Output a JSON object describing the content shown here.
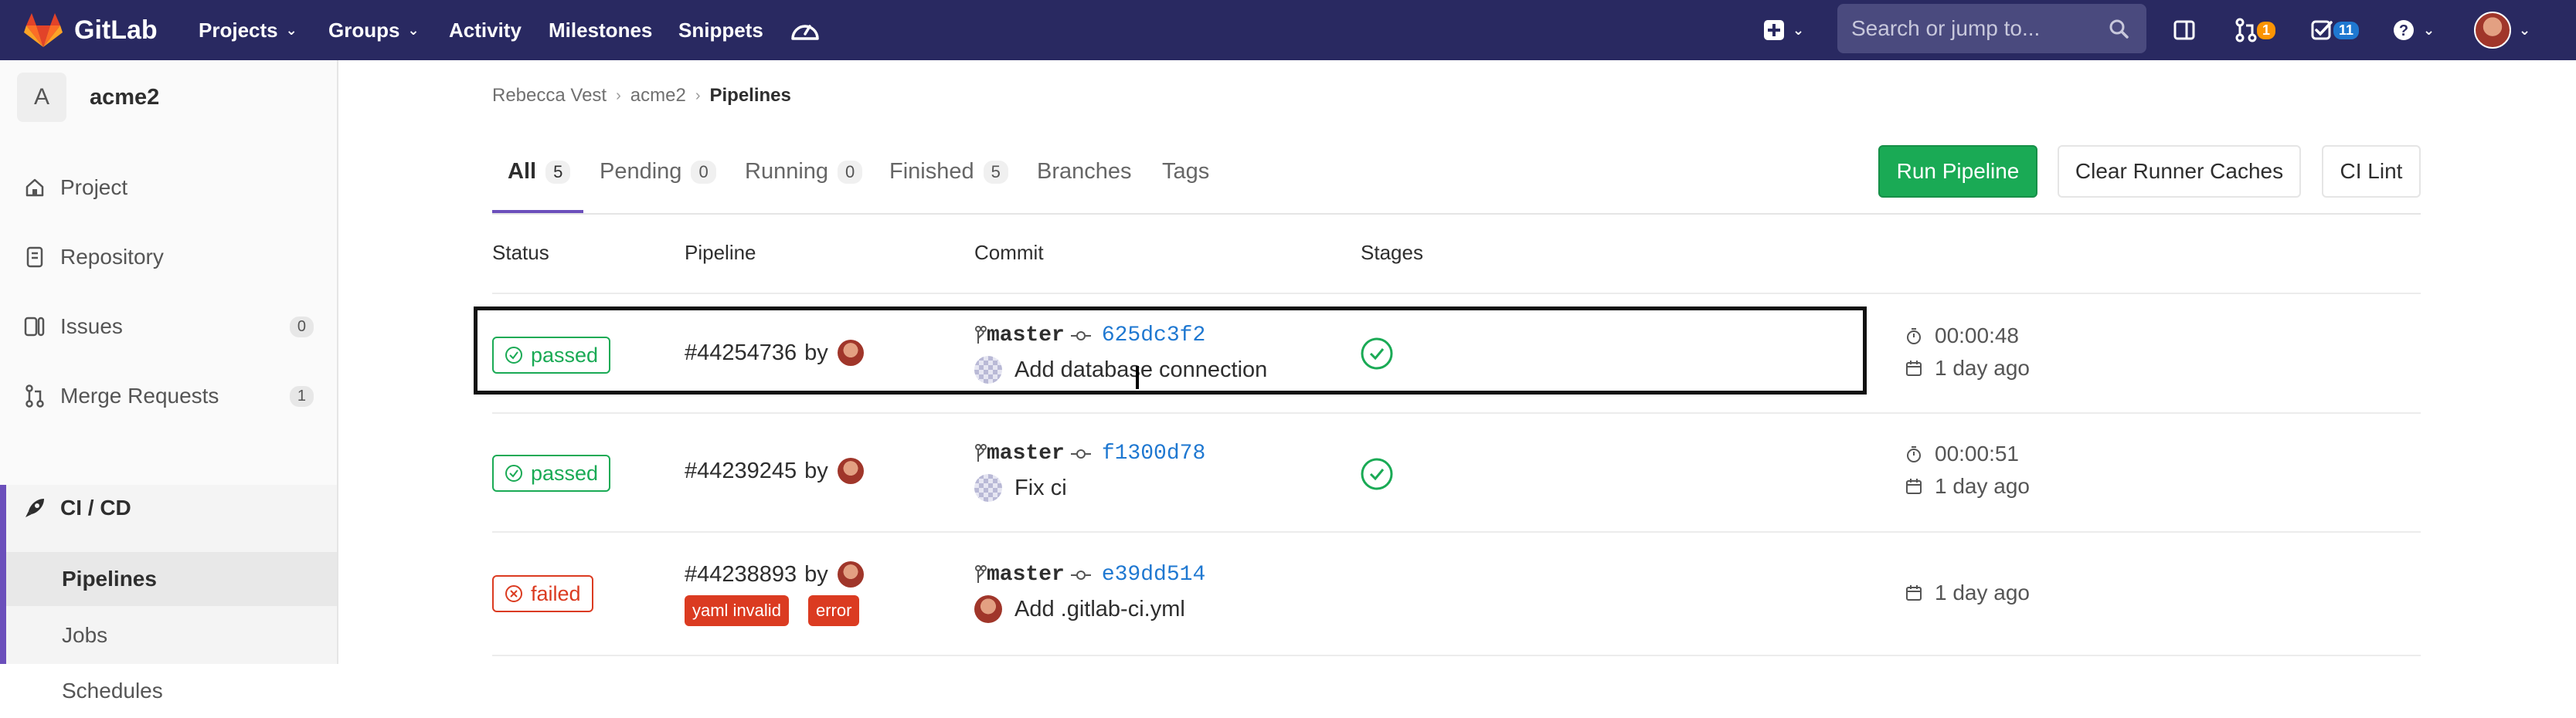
{
  "navbar": {
    "brand": "GitLab",
    "links": [
      {
        "label": "Projects",
        "dropdown": true
      },
      {
        "label": "Groups",
        "dropdown": true
      },
      {
        "label": "Activity",
        "dropdown": false
      },
      {
        "label": "Milestones",
        "dropdown": false
      },
      {
        "label": "Snippets",
        "dropdown": false
      }
    ],
    "search_placeholder": "Search or jump to...",
    "merge_requests_count": "1",
    "todos_count": "11",
    "icons": [
      "admin-area-icon",
      "plus-icon",
      "search-icon",
      "sidebar-panel-icon",
      "merge-request-icon",
      "todo-check-icon",
      "help-icon",
      "user-avatar"
    ]
  },
  "sidebar": {
    "project_initial": "A",
    "project_name": "acme2",
    "items": [
      {
        "label": "Project",
        "icon": "home-icon"
      },
      {
        "label": "Repository",
        "icon": "doc-icon"
      },
      {
        "label": "Issues",
        "icon": "issues-icon",
        "count": "0"
      },
      {
        "label": "Merge Requests",
        "icon": "merge-request-icon",
        "count": "1"
      },
      {
        "label": "CI / CD",
        "icon": "rocket-icon"
      }
    ],
    "subitems": [
      {
        "label": "Pipelines",
        "active": true
      },
      {
        "label": "Jobs",
        "active": false
      },
      {
        "label": "Schedules",
        "active": false
      }
    ]
  },
  "breadcrumb": [
    "Rebecca Vest",
    "acme2",
    "Pipelines"
  ],
  "tabs": [
    {
      "label": "All",
      "count": "5",
      "active": true
    },
    {
      "label": "Pending",
      "count": "0"
    },
    {
      "label": "Running",
      "count": "0"
    },
    {
      "label": "Finished",
      "count": "5"
    },
    {
      "label": "Branches"
    },
    {
      "label": "Tags"
    }
  ],
  "actions": {
    "run_pipeline": "Run Pipeline",
    "clear_caches": "Clear Runner Caches",
    "ci_lint": "CI Lint"
  },
  "table": {
    "headers": [
      "Status",
      "Pipeline",
      "Commit",
      "Stages"
    ],
    "rows": [
      {
        "status": "passed",
        "pipeline": "#44254736",
        "by": "by",
        "branch": "master",
        "sha": "625dc3f2",
        "message": "Add database connection",
        "duration": "00:00:48",
        "finished": "1 day ago",
        "labels": []
      },
      {
        "status": "passed",
        "pipeline": "#44239245",
        "by": "by",
        "branch": "master",
        "sha": "f1300d78",
        "message": "Fix ci",
        "duration": "00:00:51",
        "finished": "1 day ago",
        "labels": []
      },
      {
        "status": "failed",
        "pipeline": "#44238893",
        "by": "by",
        "branch": "master",
        "sha": "e39dd514",
        "message": "Add .gitlab-ci.yml",
        "duration": "",
        "finished": "1 day ago",
        "labels": [
          "yaml invalid",
          "error"
        ]
      }
    ]
  },
  "colors": {
    "navbar": "#292961",
    "accent": "#6b4fbb",
    "success": "#1aaa55",
    "danger": "#db3b21",
    "link": "#1f78d1"
  }
}
